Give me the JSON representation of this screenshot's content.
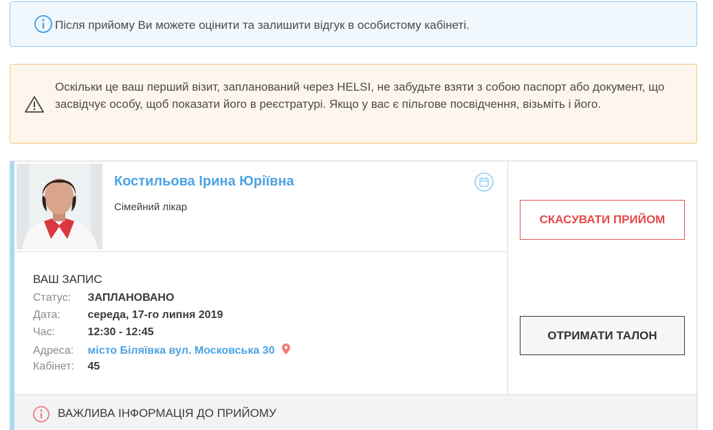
{
  "info_alert": {
    "text": "Після прийому Ви можете оцінити та залишити відгук в особистому кабінеті.",
    "icon": "info-icon",
    "color": "#4da3e4"
  },
  "warning_alert": {
    "text": "Оскільки це ваш перший візит, запланований через HELSI, не забудьте взяти з собою паспорт або документ, що засвідчує особу, щоб показати його в реєстратурі. Якщо у вас є пільгове посвідчення, візьміть і його.",
    "icon": "warning-icon"
  },
  "doctor": {
    "name": "Костильова Ірина Юріївна",
    "specialty": "Сімейний лікар",
    "photo": "doctor-photo"
  },
  "appointment": {
    "title": "ВАШ ЗАПИС",
    "rows": [
      {
        "label": "Статус:",
        "value": "ЗАПЛАНОВАНО"
      },
      {
        "label": "Дата:",
        "value": "середа, 17-го липня 2019"
      },
      {
        "label": "Час:",
        "value": "12:30 - 12:45"
      },
      {
        "label": "Адреса:",
        "value": "місто Біляївка вул. Московська 30"
      },
      {
        "label": "Кабінет:",
        "value": "45"
      }
    ]
  },
  "actions": {
    "cancel_label": "СКАСУВАТИ ПРИЙОМ",
    "ticket_label": "ОТРИМАТИ ТАЛОН"
  },
  "important": {
    "text": "ВАЖЛИВА ІНФОРМАЦІЯ ДО ПРИЙОМУ"
  },
  "colors": {
    "accent": "#4da3e4",
    "danger": "#e84848",
    "warning_border": "#f1c77d"
  }
}
